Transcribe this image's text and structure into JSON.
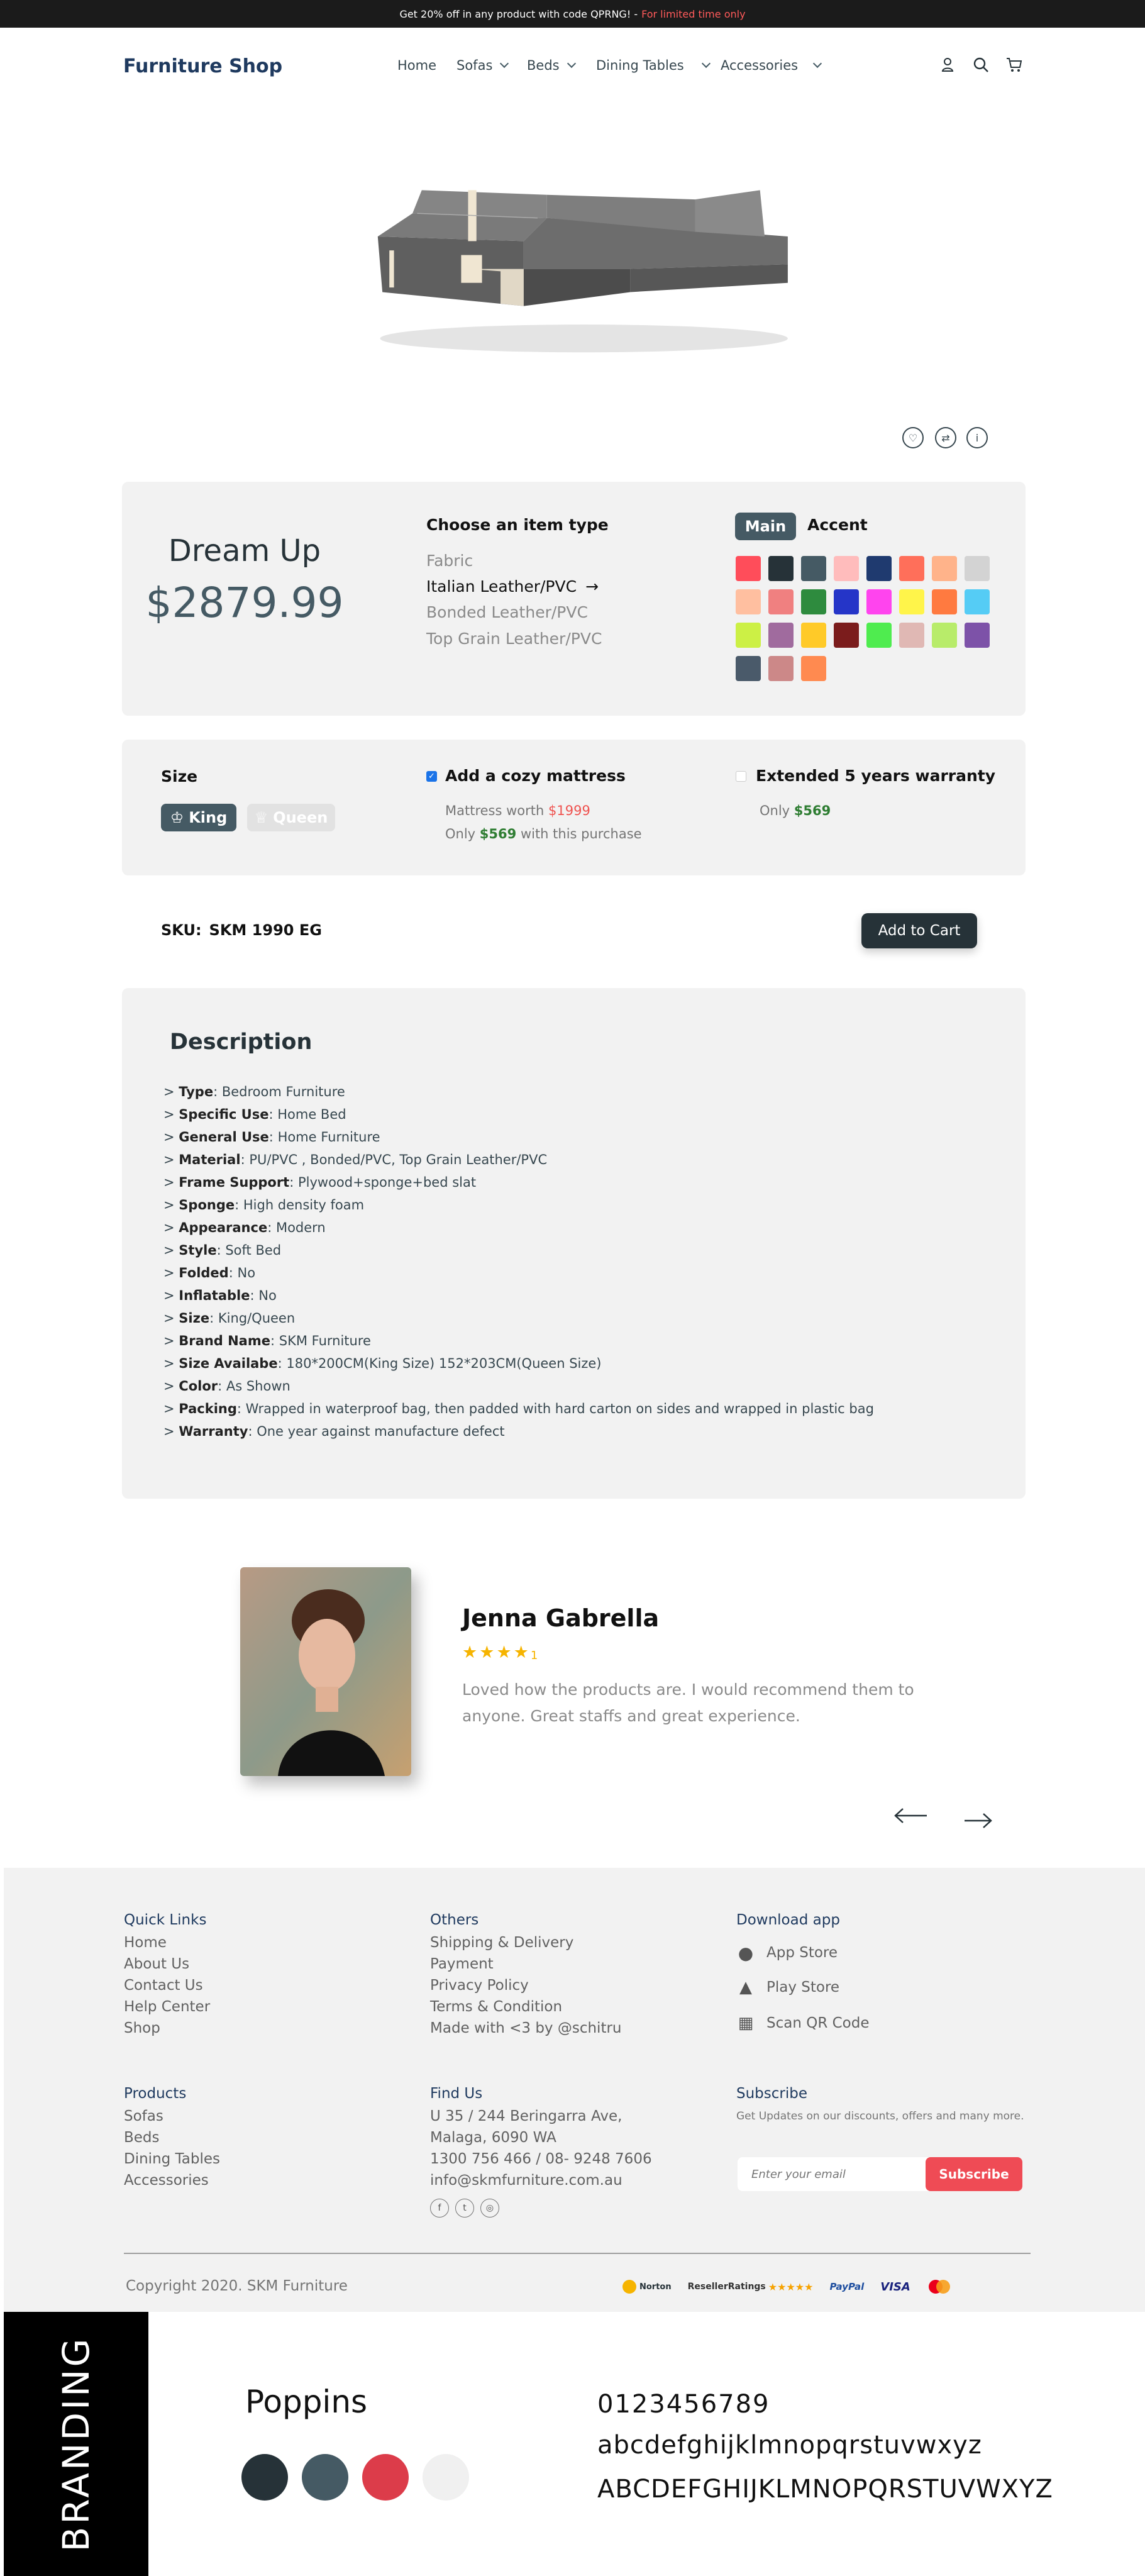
{
  "promo": {
    "text": "Get 20% off in any product with code QPRNG! -",
    "highlight": "For limited time only"
  },
  "nav": {
    "logo": "Furniture Shop",
    "items": [
      {
        "label": "Home",
        "dropdown": false
      },
      {
        "label": "Sofas",
        "dropdown": true
      },
      {
        "label": "Beds",
        "dropdown": true
      },
      {
        "label": "Dining Tables",
        "dropdown": true
      },
      {
        "label": "Accessories",
        "dropdown": true
      }
    ],
    "icons": [
      "user-icon",
      "search-icon",
      "cart-icon"
    ]
  },
  "actions": {
    "icons": [
      "heart-icon",
      "compare-icon",
      "info-icon"
    ]
  },
  "product": {
    "name": "Dream Up",
    "price": "$2879.99"
  },
  "item_type": {
    "heading": "Choose an item type",
    "options": [
      "Fabric",
      "Italian Leather/PVC",
      "Bonded Leather/PVC",
      "Top Grain Leather/PVC"
    ],
    "selected": "Italian Leather/PVC"
  },
  "color_tabs": {
    "main": "Main",
    "accent": "Accent"
  },
  "colors": [
    "#ff4d5a",
    "#263238",
    "#455a64",
    "#ffbcbc",
    "#1f3a6f",
    "#ff6f5a",
    "#ffb38a",
    "#d3d3d3",
    "#ffbfa0",
    "#f08080",
    "#2e8b3e",
    "#2535c8",
    "#ff44ee",
    "#fff44a",
    "#ff7a40",
    "#55ccf5",
    "#ccf045",
    "#a06b9e",
    "#ffca28",
    "#7b1c1c",
    "#4fec4f",
    "#e0b8b4",
    "#b8ec6a",
    "#7d52a8",
    "#4a5a6a",
    "#cc8888",
    "#ff8a50"
  ],
  "options": {
    "size_heading": "Size",
    "size_king": "King",
    "size_queen": "Queen",
    "mattress_label": "Add a cozy mattress",
    "mattress_worth_prefix": "Mattress worth",
    "mattress_worth": "$1999",
    "mattress_only_prefix": "Only",
    "mattress_price": "$569",
    "mattress_suffix": "with this purchase",
    "warranty_label": "Extended 5 years warranty",
    "warranty_prefix": "Only",
    "warranty_price": "$569"
  },
  "sku": {
    "label": "SKU:",
    "value": "SKM 1990 EG",
    "button": "Add to Cart"
  },
  "description": {
    "heading": "Description",
    "items": [
      {
        "key": "Type",
        "value": "Bedroom Furniture"
      },
      {
        "key": "Specific Use",
        "value": "Home Bed"
      },
      {
        "key": "General Use",
        "value": "Home Furniture"
      },
      {
        "key": "Material",
        "value": "PU/PVC , Bonded/PVC, Top Grain Leather/PVC"
      },
      {
        "key": "Frame Support",
        "value": "Plywood+sponge+bed slat"
      },
      {
        "key": "Sponge",
        "value": "High density foam"
      },
      {
        "key": "Appearance",
        "value": "Modern"
      },
      {
        "key": "Style",
        "value": "Soft Bed"
      },
      {
        "key": "Folded",
        "value": "No"
      },
      {
        "key": "Inflatable",
        "value": "No"
      },
      {
        "key": "Size",
        "value": "King/Queen"
      },
      {
        "key": "Brand Name",
        "value": "SKM Furniture"
      },
      {
        "key": "Size Availabe",
        "value": "180*200CM(King Size) 152*203CM(Queen Size)"
      },
      {
        "key": "Color",
        "value": "As Shown"
      },
      {
        "key": "Packing",
        "value": "Wrapped in waterproof bag, then padded with hard carton on sides and wrapped in plastic bag"
      },
      {
        "key": "Warranty",
        "value": "One year against manufacture defect"
      }
    ]
  },
  "review": {
    "name": "Jenna Gabrella",
    "rating": 4,
    "rating_label": "1",
    "text_line1": "Loved how the products are. I would recommend them to",
    "text_line2": "anyone. Great staffs and great experience."
  },
  "footer": {
    "quick_links": {
      "heading": "Quick Links",
      "items": [
        "Home",
        "About Us",
        "Contact Us",
        "Help Center",
        "Shop"
      ]
    },
    "others": {
      "heading": "Others",
      "items": [
        "Shipping & Delivery",
        "Payment",
        "Privacy Policy",
        "Terms & Condition",
        "Made with <3 by @schitru"
      ]
    },
    "download": {
      "heading": "Download app",
      "items": [
        "App Store",
        "Play Store",
        "Scan QR Code"
      ]
    },
    "products": {
      "heading": "Products",
      "items": [
        "Sofas",
        "Beds",
        "Dining Tables",
        "Accessories"
      ]
    },
    "find_us": {
      "heading": "Find Us",
      "items": [
        "U 35 / 244 Beringarra Ave,",
        "Malaga, 6090 WA",
        "1300 756 466 / 08- 9248 7606",
        "info@skmfurniture.com.au"
      ]
    },
    "subscribe": {
      "heading": "Subscribe",
      "text": "Get Updates on our discounts, offers and many more.",
      "placeholder": "Enter your email",
      "button": "Subscribe"
    },
    "copyright": "Copyright 2020. SKM Furniture",
    "badges": {
      "norton": "Norton",
      "reseller": "ResellerRatings",
      "stars": "★★★★★",
      "paypal": "PayPal",
      "visa": "VISA"
    }
  },
  "branding": {
    "label": "BRANDING",
    "font_name": "Poppins",
    "digits": "0123456789",
    "lower": "abcdefghijklmnopqrstuvwxyz",
    "upper": "ABCDEFGHIJKLMNOPQRSTUVWXYZ",
    "swatches": [
      "#263238",
      "#455a64",
      "#dc3c4a",
      "#f0f0f0"
    ]
  }
}
